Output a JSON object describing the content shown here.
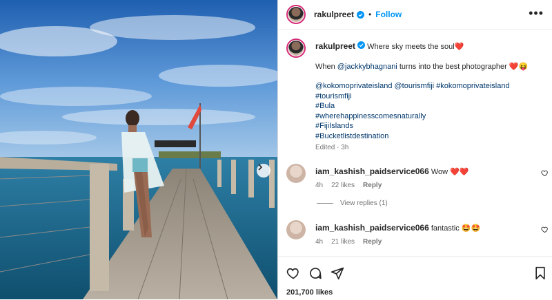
{
  "post": {
    "username": "rakulpreet",
    "follow_label": "Follow",
    "more_label": "•••",
    "caption": {
      "username": "rakulpreet",
      "text1": "Where sky meets the soul",
      "line2_pre": "When ",
      "mention": "@jackkybhagnani",
      "line2_post": " turns into the best photographer",
      "tags_line1": "@kokomoprivateisland @tourismfiji #kokomoprivateisland",
      "tags_line2": "#tourismfiji",
      "tags_line3": "#Bula",
      "tags_line4": "#wherehappinesscomesnaturally",
      "tags_line5": "#FijiIslands",
      "tags_line6": "#Bucketlistdestination",
      "meta": "Edited · 3h"
    },
    "comments": [
      {
        "username": "iam_kashish_paidservice066",
        "text": "Wow",
        "emoji": "❤️❤️",
        "age": "4h",
        "likes": "22 likes",
        "reply": "Reply"
      },
      {
        "username": "iam_kashish_paidservice066",
        "text": "fantastic",
        "emoji": "🤩🤩",
        "age": "4h",
        "likes": "21 likes",
        "reply": "Reply"
      }
    ],
    "view_replies": "View replies (1)",
    "likes_count": "201,700 likes",
    "emoji_heart": "❤️",
    "emoji_face": "😝",
    "icons": [
      "heart-icon",
      "comment-icon",
      "share-icon",
      "bookmark-icon",
      "verified-badge-icon",
      "chevron-right-icon"
    ],
    "colors": {
      "accent": "#0095f6",
      "link": "#00376b",
      "ring": "#d62976"
    }
  }
}
